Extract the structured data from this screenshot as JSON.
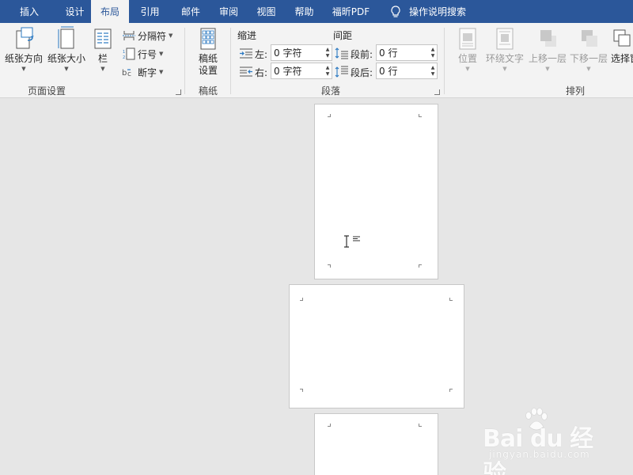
{
  "tabs": [
    {
      "label": "插入",
      "active": false
    },
    {
      "label": "设计",
      "active": false
    },
    {
      "label": "布局",
      "active": true
    },
    {
      "label": "引用",
      "active": false
    },
    {
      "label": "邮件",
      "active": false
    },
    {
      "label": "审阅",
      "active": false
    },
    {
      "label": "视图",
      "active": false
    },
    {
      "label": "帮助",
      "active": false
    },
    {
      "label": "福昕PDF",
      "active": false
    }
  ],
  "tell_me": "操作说明搜索",
  "page_setup": {
    "group_label": "页面设置",
    "orientation": "纸张方向",
    "size": "纸张大小",
    "columns": "栏",
    "breaks": "分隔符",
    "line_numbers": "行号",
    "hyphenation": "断字"
  },
  "manuscript": {
    "group_label": "稿纸",
    "button_line1": "稿纸",
    "button_line2": "设置"
  },
  "paragraph": {
    "group_label": "段落",
    "indent_heading": "缩进",
    "spacing_heading": "间距",
    "left_label": "左:",
    "left_value": "0 字符",
    "right_label": "右:",
    "right_value": "0 字符",
    "before_label": "段前:",
    "before_value": "0 行",
    "after_label": "段后:",
    "after_value": "0 行"
  },
  "arrange": {
    "group_label": "排列",
    "position": "位置",
    "wrap_text": "环绕文字",
    "bring_forward": "上移一层",
    "send_backward": "下移一层",
    "selection_pane": "选择窗"
  },
  "watermark": {
    "brand": "Bai du 经验",
    "url": "jingyan.baidu.com"
  },
  "colors": {
    "tab_bar": "#2b579a",
    "ribbon": "#f3f3f3",
    "canvas": "#e6e6e6"
  }
}
